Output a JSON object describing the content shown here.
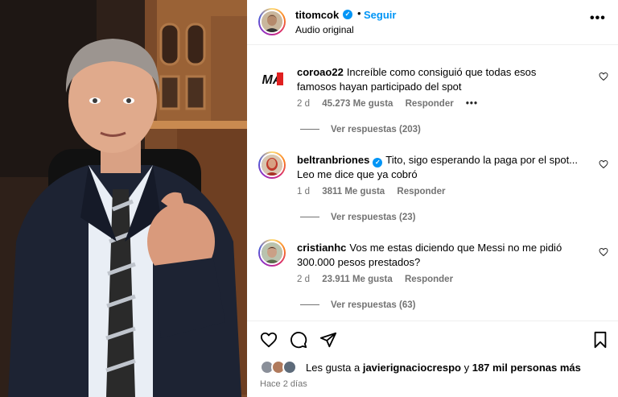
{
  "post": {
    "username": "titomcok",
    "follow_label": "Seguir",
    "audio_label": "Audio original",
    "more_label": "•••"
  },
  "comments": [
    {
      "username": "coroao22",
      "text": "Increíble como consiguió que todas esos famosos hayan participado del spot",
      "time": "2 d",
      "likes": "45.273 Me gusta",
      "reply_label": "Responder",
      "options_label": "•••",
      "replies_label": "Ver respuestas (203)",
      "avatar_text": "MA"
    },
    {
      "username": "beltranbriones",
      "text": "Tito, sigo esperando la paga por el spot... Leo me dice que ya cobró",
      "time": "1 d",
      "likes": "3811 Me gusta",
      "reply_label": "Responder",
      "replies_label": "Ver respuestas (23)"
    },
    {
      "username": "cristianhc",
      "text": "Vos me estas diciendo que Messi no me pidió 300.000 pesos prestados?",
      "time": "2 d",
      "likes": "23.911 Me gusta",
      "reply_label": "Responder",
      "replies_label": "Ver respuestas (63)"
    }
  ],
  "footer": {
    "likes_prefix": "Les gusta a",
    "liked_by_user": "javierignaciocrespo",
    "likes_connector": "y",
    "likes_others": "187 mil personas más",
    "time_ago": "Hace 2 días"
  },
  "icons": {
    "like": "heart-icon",
    "comment": "comment-icon",
    "share": "send-icon",
    "save": "bookmark-icon"
  },
  "colors": {
    "accent": "#0095f6",
    "muted": "#737373",
    "verified": "#0095f6"
  }
}
